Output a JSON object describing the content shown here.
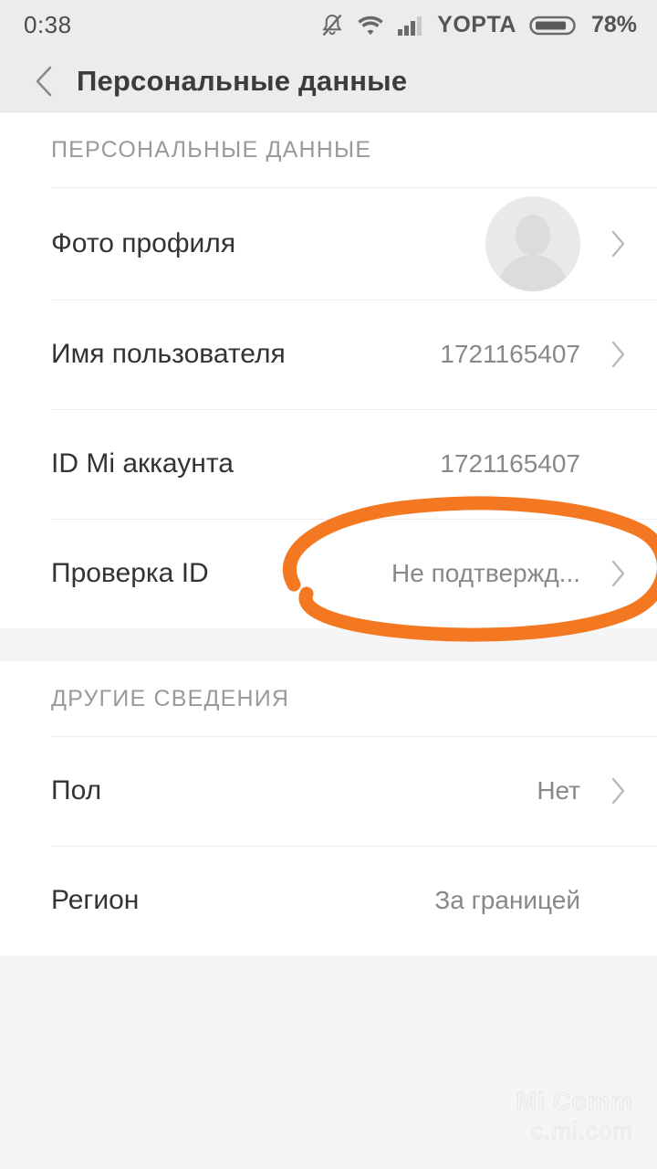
{
  "status_bar": {
    "time": "0:38",
    "carrier": "YOPTA",
    "battery_percent": "78%",
    "icons": [
      "bell-muted-icon",
      "wifi-icon",
      "signal-bars-icon",
      "battery-icon"
    ]
  },
  "header": {
    "back_icon": "back-chevron-icon",
    "title": "Персональные данные"
  },
  "sections": [
    {
      "header": "ПЕРСОНАЛЬНЫЕ ДАННЫЕ",
      "rows": [
        {
          "label": "Фото профиля",
          "value": "",
          "accessory": "avatar",
          "chevron": true
        },
        {
          "label": "Имя пользователя",
          "value": "1721165407",
          "accessory": "text",
          "chevron": true
        },
        {
          "label": "ID Mi аккаунта",
          "value": "1721165407",
          "accessory": "text",
          "chevron": false
        },
        {
          "label": "Проверка ID",
          "value": "Не подтвержд...",
          "accessory": "text",
          "chevron": true
        }
      ]
    },
    {
      "header": "ДРУГИЕ СВЕДЕНИЯ",
      "rows": [
        {
          "label": "Пол",
          "value": "Нет",
          "accessory": "text",
          "chevron": true
        },
        {
          "label": "Регион",
          "value": "За границей",
          "accessory": "text",
          "chevron": false
        }
      ]
    }
  ],
  "annotation": {
    "shape": "hand-drawn-ellipse",
    "color": "#F47721",
    "targets": "Проверка ID / Не подтвержд..."
  },
  "watermark": {
    "line1": "Mi Comm",
    "line2": "c.mi.com"
  },
  "colors": {
    "accent_orange": "#F47721",
    "bar_background": "#ECECEC",
    "page_background": "#F5F5F5",
    "list_background": "#FFFFFF",
    "label_text": "#333333",
    "value_text": "#888888",
    "section_text": "#9A9A9A"
  }
}
